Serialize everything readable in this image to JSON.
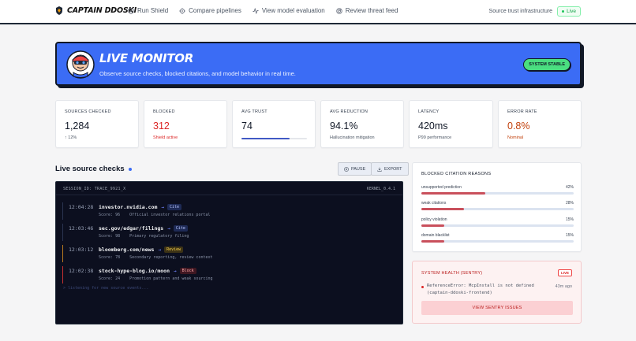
{
  "brand": {
    "name": "CAPTAIN DDOSKI"
  },
  "nav": {
    "links": [
      {
        "label": "Run Shield",
        "icon": "shield-icon"
      },
      {
        "label": "Compare pipelines",
        "icon": "gear-icon"
      },
      {
        "label": "View model evaluation",
        "icon": "activity-icon"
      },
      {
        "label": "Review threat feed",
        "icon": "radar-icon"
      }
    ],
    "right_text": "Source trust infrastructure",
    "live_label": "Live"
  },
  "hero": {
    "title": "LIVE MONITOR",
    "subtitle": "Observe source checks, blocked citations, and model behavior in real time.",
    "status_button": "SYSTEM STABLE"
  },
  "stats": [
    {
      "label": "SOURCES CHECKED",
      "value": "1,284",
      "sub": "↑ 12%"
    },
    {
      "label": "BLOCKED",
      "value": "312",
      "sub": "Shield active"
    },
    {
      "label": "AVG TRUST",
      "value": "74",
      "bar_fraction": 0.74
    },
    {
      "label": "AVG REDUCTION",
      "value": "94.1%",
      "sub": "Hallucination mitigation"
    },
    {
      "label": "LATENCY",
      "value": "420ms",
      "sub": "P99 performance"
    },
    {
      "label": "ERROR RATE",
      "value": "0.8%",
      "sub": "Nominal"
    }
  ],
  "checks": {
    "title": "Live source checks",
    "pause_label": "PAUSE",
    "export_label": "EXPORT",
    "session": "SESSION_ID: TRACE_9921_X",
    "kernel": "KERNEL_0.4.1",
    "logs": [
      {
        "time": "12:04:28",
        "domain": "investor.nvidia.com",
        "badge": "Cite",
        "score": "Score: 96",
        "note": "Official investor relations portal",
        "accent": "#2a3350"
      },
      {
        "time": "12:03:46",
        "domain": "sec.gov/edgar/filings",
        "badge": "Cite",
        "score": "Score: 98",
        "note": "Primary regulatory filing",
        "accent": "#2a3350"
      },
      {
        "time": "12:03:12",
        "domain": "bloomberg.com/news",
        "badge": "Review",
        "score": "Score: 78",
        "note": "Secondary reporting, review context",
        "accent": "#b7791f"
      },
      {
        "time": "12:02:38",
        "domain": "stock-hype-blog.io/moon",
        "badge": "Block",
        "score": "Score: 24",
        "note": "Promotion pattern and weak sourcing",
        "accent": "#c53030"
      }
    ],
    "listening": "> listening for new source events..."
  },
  "reasons": {
    "title": "BLOCKED CITATION REASONS",
    "items": [
      {
        "name": "unsupported prediction",
        "pct_label": "42%",
        "value": 0.42
      },
      {
        "name": "weak citations",
        "pct_label": "28%",
        "value": 0.28
      },
      {
        "name": "policy violation",
        "pct_label": "15%",
        "value": 0.15
      },
      {
        "name": "domain blacklist",
        "pct_label": "15%",
        "value": 0.15
      }
    ]
  },
  "health": {
    "title": "SYSTEM HEALTH (SENTRY)",
    "live": "LIVE",
    "error": "ReferenceError: McpInstall is not defined (captain-ddoski-frontend)",
    "time": "43m ago",
    "button": "VIEW SENTRY ISSUES"
  }
}
